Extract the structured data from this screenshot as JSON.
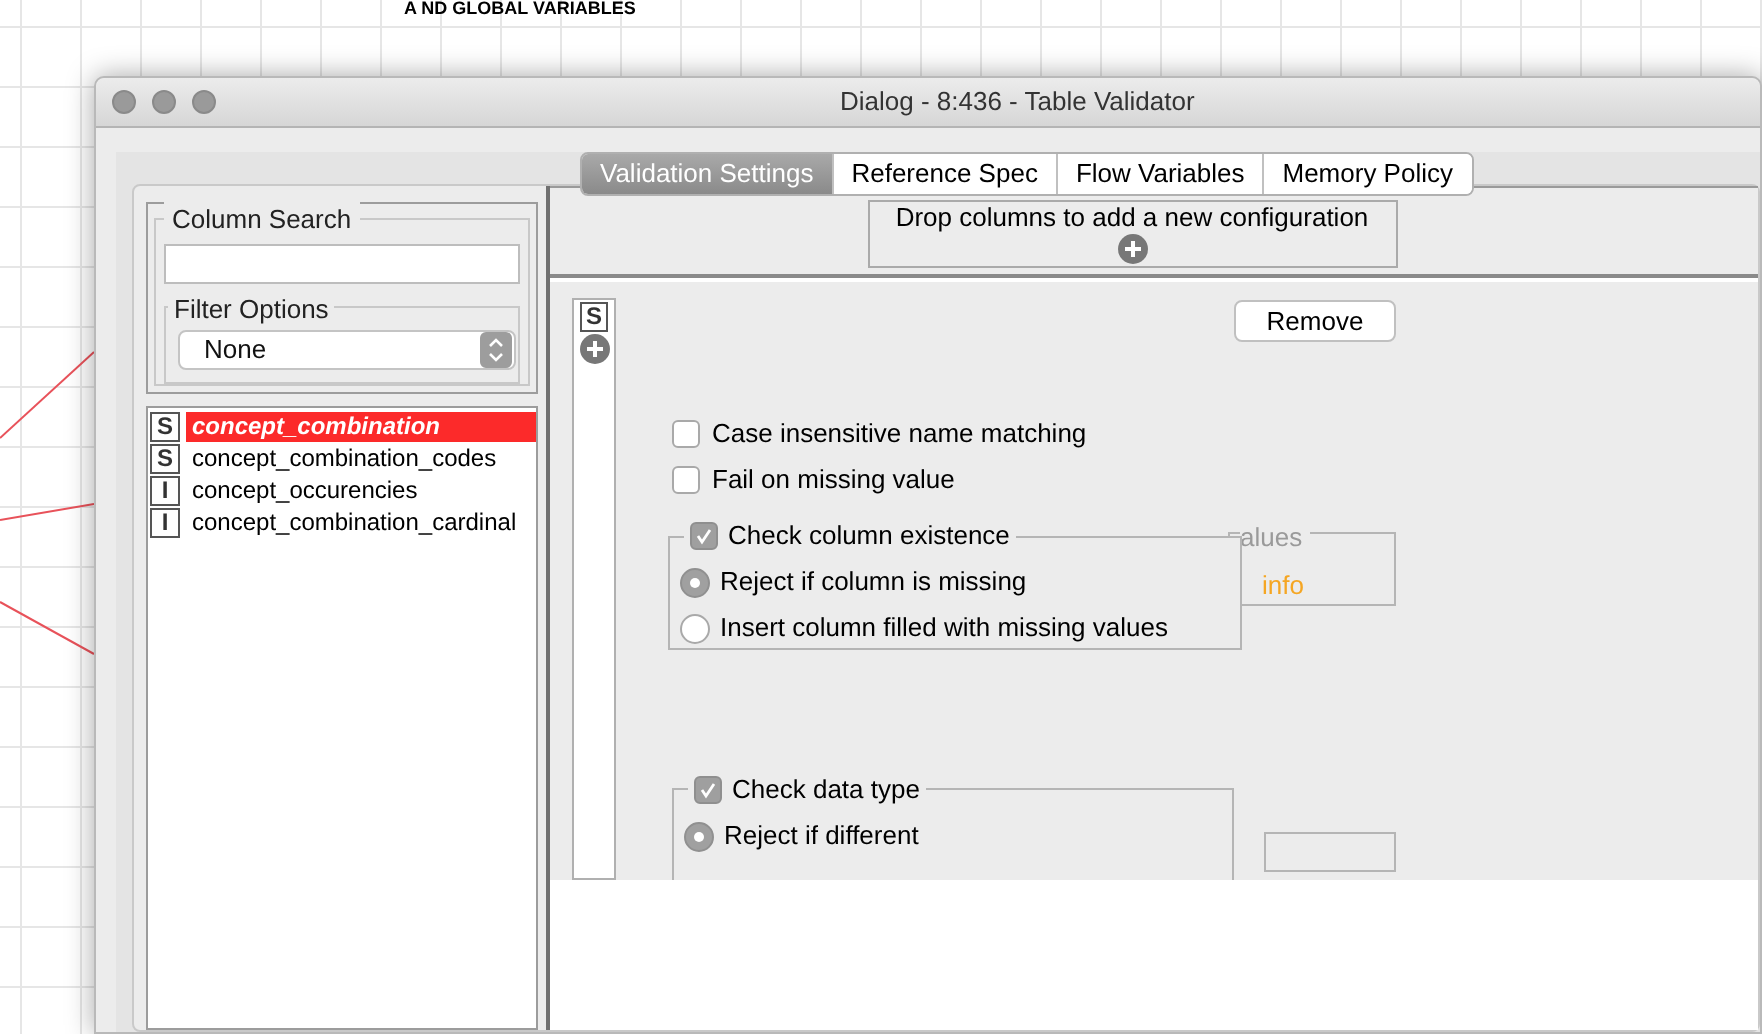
{
  "canvas": {
    "annotation": "A ND GLOBAL VARIABLES"
  },
  "window": {
    "title": "Dialog - 8:436 - Table Validator"
  },
  "tabs": [
    {
      "label": "Validation Settings",
      "selected": true
    },
    {
      "label": "Reference Spec",
      "selected": false
    },
    {
      "label": "Flow Variables",
      "selected": false
    },
    {
      "label": "Memory Policy",
      "selected": false
    }
  ],
  "column_search": {
    "title": "Column Search"
  },
  "filter_options": {
    "title": "Filter Options",
    "value": "None"
  },
  "columns": [
    {
      "type": "S",
      "name": "concept_combination",
      "selected": true
    },
    {
      "type": "S",
      "name": "concept_combination_codes",
      "selected": false
    },
    {
      "type": "I",
      "name": "concept_occurencies",
      "selected": false
    },
    {
      "type": "I",
      "name": "concept_combination_cardinal",
      "selected": false
    }
  ],
  "drop_area": {
    "label": "Drop columns to add a new configuration"
  },
  "configuration": {
    "type_badge": "S",
    "remove_button": "Remove",
    "options": [
      {
        "label": "Case insensitive name matching",
        "checked": false
      },
      {
        "label": "Fail on missing value",
        "checked": false
      }
    ],
    "existence_group": {
      "label": "Check column existence",
      "checked": true,
      "radios": [
        {
          "label": "Reject if column is missing",
          "selected": true
        },
        {
          "label": "Insert column filled with missing values",
          "selected": false
        }
      ]
    },
    "hidden_group": {
      "title": "alues",
      "value": "info"
    },
    "data_type_group": {
      "label": "Check data type",
      "checked": true,
      "radios": [
        {
          "label": "Reject if different",
          "selected": true
        }
      ]
    }
  }
}
